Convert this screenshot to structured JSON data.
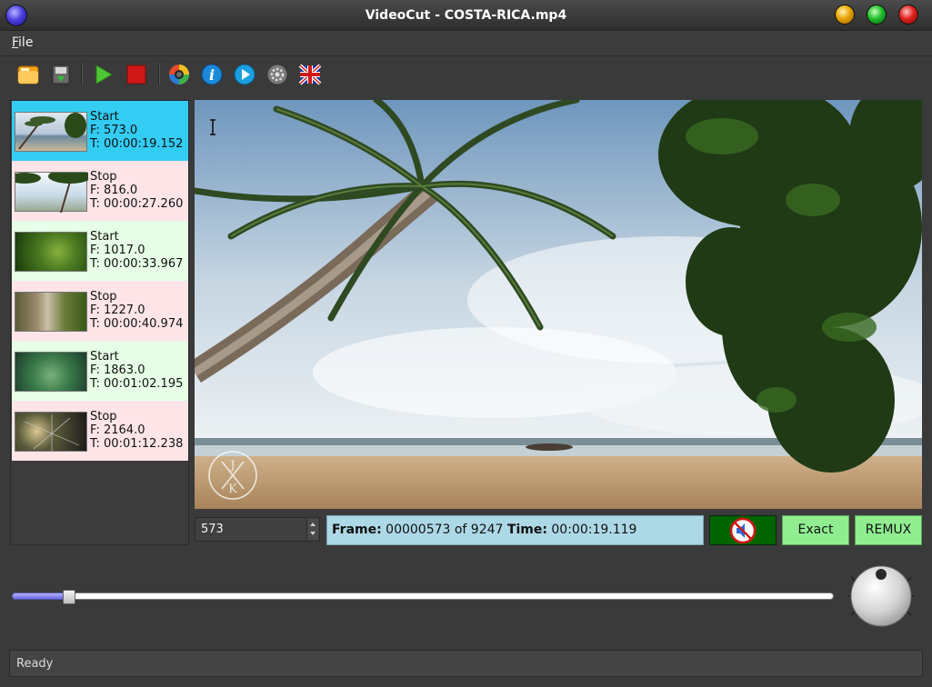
{
  "window": {
    "title": "VideoCut - COSTA-RICA.mp4"
  },
  "menu": {
    "file_mnemonic": "F",
    "file_rest": "ile"
  },
  "toolbar": {
    "icons": [
      "open-folder-icon",
      "save-icon",
      "play-icon",
      "stop-icon",
      "camera-icon",
      "info-icon",
      "media-play-icon",
      "settings-icon",
      "language-flag-icon"
    ]
  },
  "markers": [
    {
      "type": "Start",
      "frame": "F: 573.0",
      "time": "T: 00:00:19.152",
      "state": "selected"
    },
    {
      "type": "Stop",
      "frame": "F: 816.0",
      "time": "T: 00:00:27.260",
      "state": "stop"
    },
    {
      "type": "Start",
      "frame": "F: 1017.0",
      "time": "T: 00:00:33.967",
      "state": "start"
    },
    {
      "type": "Stop",
      "frame": "F: 1227.0",
      "time": "T: 00:00:40.974",
      "state": "stop"
    },
    {
      "type": "Start",
      "frame": "F: 1863.0",
      "time": "T: 00:01:02.195",
      "state": "start"
    },
    {
      "type": "Stop",
      "frame": "F: 2164.0",
      "time": "T: 00:01:12.238",
      "state": "stop"
    }
  ],
  "colors": {
    "selected": "#33ccf3",
    "start": "#e6ffe6",
    "stop": "#ffe4e8",
    "info_bg": "#add8e6",
    "mute_bg": "#006400",
    "button_green": "#90ee90"
  },
  "frame_input": {
    "value": "573"
  },
  "info": {
    "frame_label": "Frame:",
    "frame_value": "00000573 of 9247",
    "time_label": "Time:",
    "time_value": "00:00:19.119"
  },
  "buttons": {
    "exact": "Exact",
    "remux": "REMUX",
    "mute_icon": "muted-speaker-icon"
  },
  "slider": {
    "position_fraction": 0.062
  },
  "status": {
    "text": "Ready"
  }
}
